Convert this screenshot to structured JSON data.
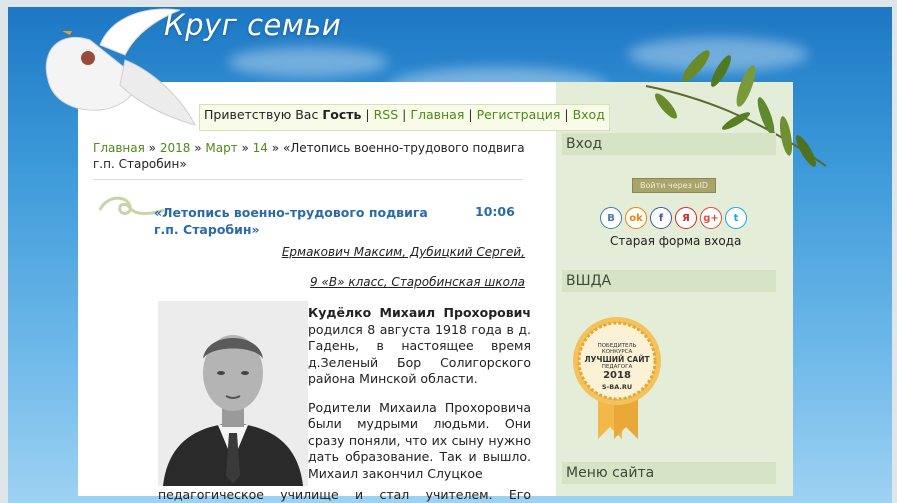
{
  "site": {
    "title": "Круг семьи"
  },
  "greeting": {
    "prefix": "Приветствую Вас",
    "user": "Гость",
    "links": [
      "RSS",
      "Главная",
      "Регистрация",
      "Вход"
    ]
  },
  "breadcrumb": {
    "items": [
      "Главная",
      "2018",
      "Март",
      "14"
    ],
    "current": "«Летопись военно-трудового подвига г.п. Старобин»"
  },
  "post": {
    "title": "«Летопись военно-трудового подвига г.п. Старобин»",
    "time": "10:06",
    "authors": "Ермакович Максим, Дубицкий Сергей,",
    "class_school": "9 «В» класс, Старобинская школа",
    "name": "Кудёлко Михаил Прохорович",
    "p1": "родился 8 августа 1918 года в д. Гадень, в настоящее время д.Зеленый Бор Солигорского района Минской области.",
    "p2": "Родители Михаила Прохоровича были мудрыми людьми. Они сразу поняли, что их сыну нужно дать образование. Так и вышло. Михаил закончил Слуцкое",
    "tail": "педагогическое училище и стал учителем. Его"
  },
  "sidebar": {
    "login_title": "Вход",
    "uid_button": "Войти через uID",
    "socials": [
      {
        "icon": "vk-icon",
        "glyph": "В",
        "color": "#4a76a8"
      },
      {
        "icon": "odnoklassniki-icon",
        "glyph": "ok",
        "color": "#ee8208"
      },
      {
        "icon": "facebook-icon",
        "glyph": "f",
        "color": "#3b5998"
      },
      {
        "icon": "yandex-icon",
        "glyph": "Я",
        "color": "#d52b1e"
      },
      {
        "icon": "google-plus-icon",
        "glyph": "g+",
        "color": "#dd4b39"
      },
      {
        "icon": "twitter-icon",
        "glyph": "t",
        "color": "#1da1f2"
      }
    ],
    "old_login": "Старая форма входа",
    "vshda_title": "ВШДА",
    "badge": {
      "line1": "ПОБЕДИТЕЛЬ",
      "line2": "КОНКУРСА",
      "line3": "ЛУЧШИЙ САЙТ",
      "line4": "ПЕДАГОГА",
      "year": "2018",
      "site": "S-BA.RU"
    },
    "menu_title": "Меню сайта"
  },
  "colors": {
    "link": "#4e8a1c",
    "title": "#2a6aa8",
    "sidebar_bg": "#e4edd8"
  }
}
